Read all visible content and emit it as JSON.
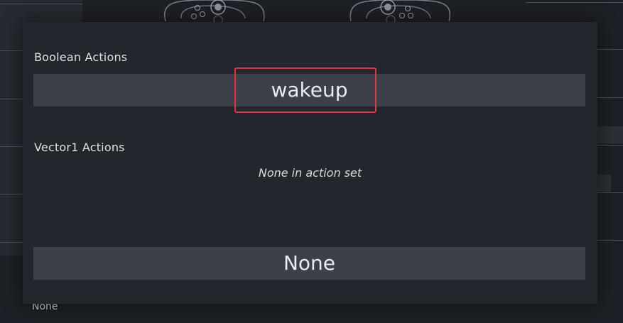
{
  "modal": {
    "boolean_section_title": "Boolean Actions",
    "boolean_actions": [
      "wakeup"
    ],
    "vector1_section_title": "Vector1 Actions",
    "vector1_empty_text": "None in action set",
    "none_button_label": "None"
  },
  "background": {
    "bottom_left_label": "None"
  },
  "colors": {
    "modal_bg": "#23262d",
    "button_bg": "#3d4049",
    "highlight": "#e0353b",
    "text": "#e9ebee"
  }
}
